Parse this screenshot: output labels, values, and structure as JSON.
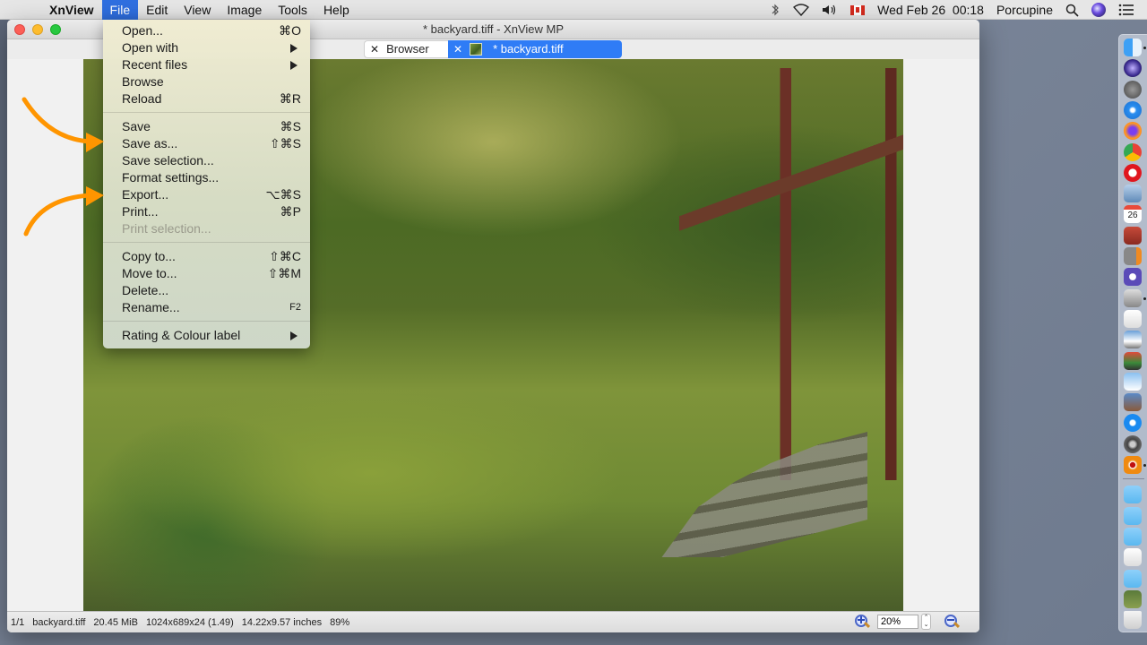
{
  "menubar": {
    "app_name": "XnView",
    "menus": [
      "File",
      "Edit",
      "View",
      "Image",
      "Tools",
      "Help"
    ],
    "active_menu": "File",
    "clock": "Wed Feb 26  00:18",
    "user": "Porcupine",
    "status_icons": [
      "bluetooth-icon",
      "wifi-icon",
      "volume-icon",
      "canada-flag-icon",
      "spotlight-search-icon",
      "siri-icon",
      "notification-center-icon"
    ]
  },
  "window": {
    "title": "* backyard.tiff - XnView MP",
    "tabs": [
      {
        "label": "Browser",
        "active": false
      },
      {
        "label": "* backyard.tiff",
        "active": true
      }
    ]
  },
  "file_menu": {
    "groups": [
      [
        {
          "label": "Open...",
          "shortcut": "⌘O"
        },
        {
          "label": "Open with",
          "submenu": true
        },
        {
          "label": "Recent files",
          "submenu": true
        },
        {
          "label": "Browse"
        },
        {
          "label": "Reload",
          "shortcut": "⌘R"
        }
      ],
      [
        {
          "label": "Save",
          "shortcut": "⌘S"
        },
        {
          "label": "Save as...",
          "shortcut": "⇧⌘S"
        },
        {
          "label": "Save selection..."
        },
        {
          "label": "Format settings..."
        },
        {
          "label": "Export...",
          "shortcut": "⌥⌘S"
        },
        {
          "label": "Print...",
          "shortcut": "⌘P"
        },
        {
          "label": "Print selection...",
          "disabled": true
        }
      ],
      [
        {
          "label": "Copy to...",
          "shortcut": "⇧⌘C"
        },
        {
          "label": "Move to...",
          "shortcut": "⇧⌘M"
        },
        {
          "label": "Delete..."
        },
        {
          "label": "Rename...",
          "shortcut": "F2"
        }
      ],
      [
        {
          "label": "Rating & Colour label",
          "submenu": true
        }
      ]
    ]
  },
  "annotations": {
    "arrow_color": "#ff9500",
    "targets": [
      "Save as...",
      "Export..."
    ]
  },
  "statusbar": {
    "index": "1/1",
    "filename": "backyard.tiff",
    "filesize": "20.45 MiB",
    "dimensions": "1024x689x24 (1.49)",
    "print_size": "14.22x9.57 inches",
    "quality": "89%",
    "zoom_value": "20%"
  },
  "dock": {
    "apps": [
      "Finder",
      "Siri",
      "Launchpad",
      "Safari",
      "Firefox",
      "Chrome",
      "Opera",
      "Preview",
      "Calendar",
      "Dictionary",
      "Calculator",
      "BBEdit",
      "Image Capture",
      "TextEdit",
      "Photo Viewer",
      "Photo Editor",
      "Image Tool",
      "Photo Slideshow",
      "App Store",
      "System Preferences",
      "XnView MP"
    ],
    "calendar_day": "26",
    "folders": [
      "Folder",
      "Folder",
      "Folder",
      "Document",
      "Folder",
      "Image Stack",
      "Trash"
    ]
  }
}
